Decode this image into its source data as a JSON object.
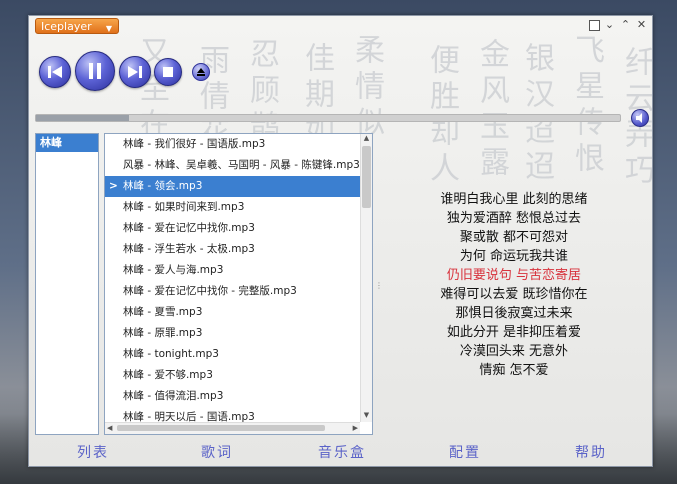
{
  "app": {
    "title": "Iceplayer"
  },
  "window_controls": [
    "restore",
    "minimize",
    "maximize",
    "close"
  ],
  "icons": {
    "prev": "previous-track-icon",
    "pause": "pause-icon",
    "next": "next-track-icon",
    "stop": "stop-icon",
    "eject": "eject-icon",
    "volume": "speaker-icon"
  },
  "progress": {
    "fraction": 0.16
  },
  "groups": [
    {
      "label": "林峰",
      "selected": true
    }
  ],
  "songs": [
    {
      "title": "林峰 - 我们很好 - 国语版.mp3"
    },
    {
      "title": "风暴 - 林峰、吴卓羲、马国明 - 风暴 - 陈键锋.mp3"
    },
    {
      "title": "林峰 - 领会.mp3",
      "active": true
    },
    {
      "title": "林峰 - 如果时间来到.mp3"
    },
    {
      "title": "林峰 - 爱在记忆中找你.mp3"
    },
    {
      "title": "林峰 - 浮生若水 - 太极.mp3"
    },
    {
      "title": "林峰 - 爱人与海.mp3"
    },
    {
      "title": "林峰 - 爱在记忆中找你 - 完整版.mp3"
    },
    {
      "title": "林峰 - 夏雪.mp3"
    },
    {
      "title": "林峰 - 原罪.mp3"
    },
    {
      "title": "林峰 - tonight.mp3"
    },
    {
      "title": "林峰 - 爱不够.mp3"
    },
    {
      "title": "林峰 - 值得流泪.mp3"
    },
    {
      "title": "林峰 - 明天以后 - 国语.mp3"
    }
  ],
  "lyrics": [
    {
      "text": "谁明白我心里 此刻的思绪"
    },
    {
      "text": "独为爱酒醉 愁恨总过去"
    },
    {
      "text": "聚或散 都不可怨对"
    },
    {
      "text": "为何 命运玩我共谁"
    },
    {
      "text": "仍旧要说句 与苦恋寄居",
      "current": true
    },
    {
      "text": "难得可以去爱 既珍惜你在"
    },
    {
      "text": "那惧日後寂寞过未来"
    },
    {
      "text": "如此分开 是非抑压着爱"
    },
    {
      "text": "冷漠回头来 无意外"
    },
    {
      "text": "情痴 怎不爱"
    }
  ],
  "nav": [
    "列表",
    "歌词",
    "音乐盒",
    "配置",
    "帮助"
  ],
  "colors": {
    "accent": "#3b7fd0",
    "highlight": "#d8323c",
    "button": "#5d63d6",
    "menu": "#e0701a"
  }
}
